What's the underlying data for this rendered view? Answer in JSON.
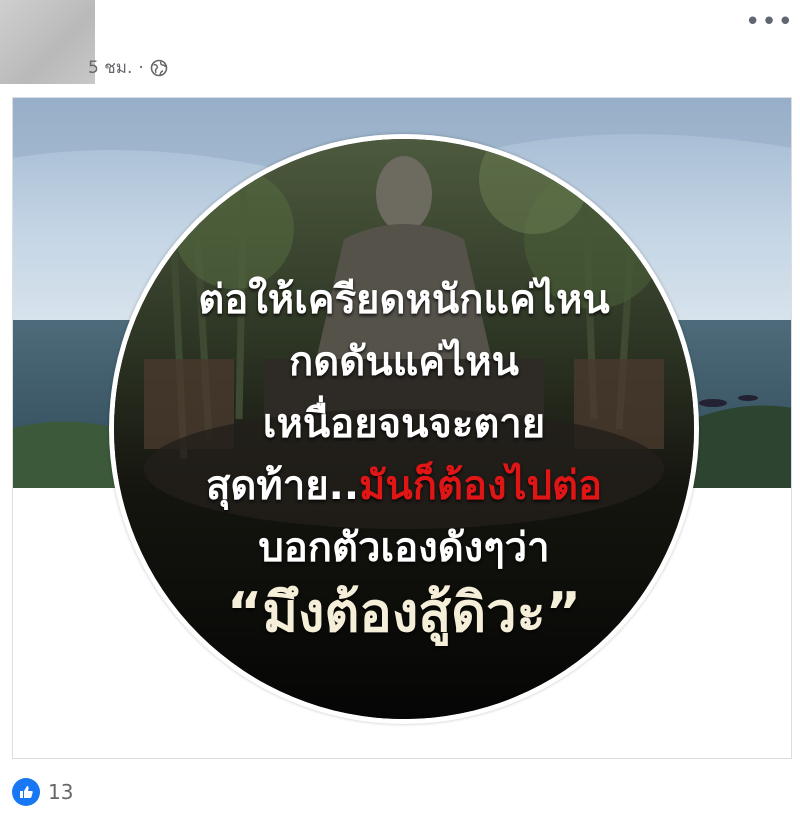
{
  "post": {
    "timestamp": "5 ชม.",
    "separator": "·",
    "privacy_icon": "globe-icon",
    "more_icon": "more-options-icon",
    "more_label": "•••"
  },
  "cover_image": {
    "quote_line1": "ต่อให้เครียดหนักแค่ไหน",
    "quote_line2": "กดดันแค่ไหน",
    "quote_line3": "เหนื่อยจนจะตาย",
    "quote_line4_white": "สุดท้าย..",
    "quote_line4_red": "มันก็ต้องไปต่อ",
    "quote_line5": "บอกตัวเองดังๆว่า",
    "quote_line6": "“มึงต้องสู้ดิวะ”",
    "highlight_color": "#e01515",
    "sky_color": "#a9c4dd",
    "sea_color": "#41606f"
  },
  "reactions": {
    "icon": "like-icon",
    "count": "13",
    "color": "#1877f2"
  }
}
